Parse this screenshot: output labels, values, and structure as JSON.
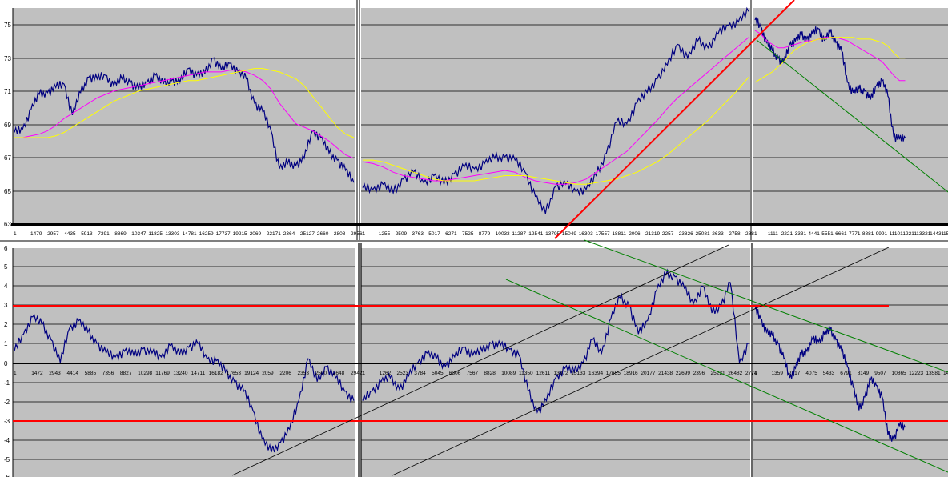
{
  "chart_data": [
    {
      "type": "line",
      "panel": "top-left",
      "ylim": [
        63,
        75.5
      ],
      "y_ticks": [
        "75",
        "73",
        "71",
        "69",
        "67",
        "65",
        "63"
      ],
      "x_ticks": [
        "1",
        "1479",
        "2957",
        "4435",
        "5913",
        "7391",
        "8869",
        "10347",
        "11825",
        "13303",
        "14781",
        "16259",
        "17737",
        "19215",
        "2069",
        "22171",
        "2364",
        "25127",
        "2660",
        "2808",
        "29561"
      ],
      "series": [
        {
          "color": "#000080",
          "values": [
            68.3,
            68.5,
            69.6,
            70.5,
            70.6,
            70.9,
            71.1,
            69.3,
            70.6,
            71.5,
            71.4,
            71.6,
            71.0,
            71.4,
            71.2,
            70.8,
            71.2,
            71.6,
            71.1,
            71.3,
            71.2,
            72.0,
            71.6,
            71.7,
            72.6,
            71.9,
            72.3,
            71.8,
            71.4,
            70.0,
            69.5,
            68.4,
            66.2,
            66.5,
            66.4,
            66.8,
            68.4,
            68.0,
            67.1,
            66.7,
            66.1,
            65.4
          ]
        },
        {
          "color": "#FF00FF",
          "values": [
            68.0,
            68.0,
            68.1,
            68.2,
            68.4,
            68.7,
            69.1,
            69.4,
            69.7,
            70.0,
            70.3,
            70.5,
            70.7,
            70.8,
            70.9,
            71.0,
            71.1,
            71.2,
            71.3,
            71.4,
            71.5,
            71.6,
            71.7,
            71.8,
            71.8,
            71.8,
            71.9,
            71.9,
            71.8,
            71.6,
            71.3,
            70.8,
            70.0,
            69.4,
            68.8,
            68.6,
            68.4,
            68.1,
            67.8,
            67.4,
            67.0,
            66.8
          ]
        },
        {
          "color": "#FFFF00",
          "values": [
            68.0,
            68.0,
            68.0,
            68.0,
            68.0,
            68.1,
            68.3,
            68.6,
            68.9,
            69.2,
            69.5,
            69.8,
            70.1,
            70.3,
            70.5,
            70.7,
            70.8,
            70.9,
            71.0,
            71.1,
            71.2,
            71.3,
            71.3,
            71.4,
            71.5,
            71.6,
            71.7,
            71.8,
            71.9,
            72.0,
            72.0,
            71.9,
            71.8,
            71.6,
            71.4,
            71.0,
            70.4,
            69.8,
            69.2,
            68.6,
            68.2,
            68.0
          ]
        }
      ]
    },
    {
      "type": "line",
      "panel": "top-middle",
      "ylim": [
        63,
        75.5
      ],
      "x_ticks": [
        "1",
        "1255",
        "2509",
        "3763",
        "5017",
        "6271",
        "7525",
        "8779",
        "10033",
        "11287",
        "12541",
        "13795",
        "15049",
        "16303",
        "17557",
        "18811",
        "2006",
        "21319",
        "2257",
        "23826",
        "25081",
        "2633",
        "2758",
        "288"
      ],
      "series": [
        {
          "color": "#000080",
          "values": [
            65.1,
            65.0,
            65.3,
            64.8,
            65.6,
            66.0,
            65.4,
            65.8,
            65.3,
            65.9,
            66.3,
            66.2,
            66.5,
            66.8,
            66.9,
            66.7,
            66.0,
            64.6,
            63.6,
            65.2,
            65.3,
            64.9,
            65.0,
            65.8,
            67.1,
            68.9,
            68.8,
            70.0,
            70.6,
            71.4,
            72.2,
            73.4,
            72.6,
            73.6,
            73.2,
            74.0,
            74.5,
            74.7,
            75.3
          ]
        },
        {
          "color": "#FF00FF",
          "values": [
            66.6,
            66.5,
            66.3,
            66.0,
            65.8,
            65.7,
            65.6,
            65.5,
            65.5,
            65.6,
            65.7,
            65.8,
            65.9,
            66.0,
            66.1,
            66.0,
            65.7,
            65.5,
            65.4,
            65.3,
            65.3,
            65.4,
            65.6,
            66.0,
            66.4,
            66.8,
            67.2,
            67.8,
            68.4,
            69.0,
            69.7,
            70.3,
            70.8,
            71.3,
            71.8,
            72.3,
            72.8,
            73.3,
            73.8
          ]
        },
        {
          "color": "#FFFF00",
          "values": [
            66.7,
            66.7,
            66.6,
            66.4,
            66.2,
            66.0,
            65.8,
            65.6,
            65.5,
            65.5,
            65.5,
            65.5,
            65.6,
            65.7,
            65.8,
            65.8,
            65.8,
            65.7,
            65.6,
            65.5,
            65.4,
            65.3,
            65.3,
            65.4,
            65.5,
            65.6,
            65.8,
            66.0,
            66.3,
            66.6,
            67.0,
            67.5,
            68.0,
            68.5,
            69.0,
            69.6,
            70.2,
            70.8,
            71.5
          ]
        }
      ]
    },
    {
      "type": "line",
      "panel": "top-right",
      "ylim": [
        63,
        75.5
      ],
      "x_ticks": [
        "1",
        "1111",
        "2221",
        "3331",
        "4441",
        "5551",
        "6661",
        "7771",
        "8881",
        "9991",
        "11101",
        "12211",
        "13321",
        "14431",
        "15541"
      ],
      "series": [
        {
          "color": "#000080",
          "values": [
            74.8,
            74.4,
            73.5,
            73.0,
            72.6,
            72.3,
            73.4,
            73.6,
            73.9,
            73.7,
            74.0,
            74.3,
            73.6,
            74.1,
            73.5,
            73.0,
            71.2,
            70.6,
            70.8,
            70.7,
            70.2,
            71.0,
            71.3,
            70.4,
            68.1,
            67.9,
            68.0
          ]
        },
        {
          "color": "#FF00FF",
          "values": [
            74.2,
            74.0,
            73.6,
            73.4,
            73.2,
            73.2,
            73.3,
            73.4,
            73.5,
            73.6,
            73.6,
            73.7,
            73.8,
            73.8,
            73.8,
            73.7,
            73.6,
            73.4,
            73.2,
            73.0,
            72.8,
            72.6,
            72.4,
            72.0,
            71.6,
            71.3,
            71.3
          ]
        },
        {
          "color": "#FFFF00",
          "values": [
            71.2,
            71.4,
            71.6,
            71.8,
            72.1,
            72.4,
            72.8,
            73.1,
            73.3,
            73.5,
            73.6,
            73.7,
            73.7,
            73.8,
            73.8,
            73.8,
            73.8,
            73.8,
            73.7,
            73.7,
            73.7,
            73.6,
            73.5,
            73.3,
            72.9,
            72.6,
            72.6
          ]
        }
      ]
    },
    {
      "type": "line",
      "panel": "bottom-left",
      "ylim": [
        -6,
        6
      ],
      "y_ticks": [
        "6",
        "5",
        "4",
        "3",
        "2",
        "1",
        "0",
        "-1",
        "-2",
        "-3",
        "-4",
        "-5",
        "-6"
      ],
      "x_ticks": [
        "1",
        "1472",
        "2943",
        "4414",
        "5885",
        "7356",
        "8827",
        "10298",
        "11769",
        "13240",
        "14711",
        "16182",
        "17653",
        "19124",
        "2059",
        "2206",
        "2353",
        "2500",
        "2648",
        "29421"
      ],
      "series": [
        {
          "color": "#000080",
          "values": [
            0.6,
            1.5,
            2.4,
            2.0,
            1.2,
            0.0,
            1.8,
            2.2,
            1.6,
            1.0,
            0.5,
            0.3,
            0.6,
            0.4,
            0.7,
            0.5,
            0.3,
            0.9,
            0.4,
            0.8,
            1.0,
            0.2,
            0.1,
            -0.5,
            -1.0,
            -1.5,
            -2.5,
            -4.0,
            -4.7,
            -4.2,
            -3.5,
            -2.0,
            0.2,
            -1.0,
            -0.2,
            -0.8,
            -1.5,
            -2.0
          ]
        }
      ]
    },
    {
      "type": "line",
      "panel": "bottom-middle",
      "ylim": [
        -6,
        6
      ],
      "x_ticks": [
        "1",
        "1262",
        "2523",
        "3784",
        "5045",
        "6306",
        "7567",
        "8828",
        "10089",
        "11350",
        "12611",
        "13872",
        "15133",
        "16394",
        "17655",
        "18916",
        "20177",
        "21438",
        "22699",
        "2396",
        "25221",
        "26482",
        "2774"
      ],
      "series": [
        {
          "color": "#000080",
          "values": [
            -2.0,
            -1.5,
            -1.0,
            -0.8,
            -1.4,
            -0.7,
            0.0,
            0.5,
            0.2,
            -0.2,
            0.3,
            0.8,
            0.4,
            0.6,
            1.0,
            0.9,
            0.7,
            0.4,
            -1.5,
            -2.6,
            -2.0,
            -0.8,
            -0.3,
            -0.5,
            0.0,
            1.2,
            0.5,
            2.3,
            3.4,
            3.0,
            1.5,
            2.2,
            3.8,
            4.6,
            4.5,
            3.9,
            3.1,
            4.0,
            2.6,
            3.0,
            4.2,
            0.0,
            1.0
          ]
        }
      ]
    },
    {
      "type": "line",
      "panel": "bottom-right",
      "ylim": [
        -6,
        6
      ],
      "x_ticks": [
        "1",
        "1359",
        "2717",
        "4075",
        "5433",
        "6791",
        "8149",
        "9507",
        "10865",
        "12223",
        "13581",
        "14939"
      ],
      "series": [
        {
          "color": "#000080",
          "values": [
            2.8,
            2.3,
            1.6,
            1.4,
            1.0,
            0.2,
            -0.8,
            -0.3,
            0.4,
            0.6,
            1.2,
            1.1,
            1.5,
            1.7,
            1.2,
            0.6,
            -0.2,
            -1.3,
            -2.5,
            -1.8,
            -0.9,
            -1.2,
            -1.8,
            -3.8,
            -4.0,
            -3.3,
            -3.4
          ]
        }
      ]
    }
  ]
}
